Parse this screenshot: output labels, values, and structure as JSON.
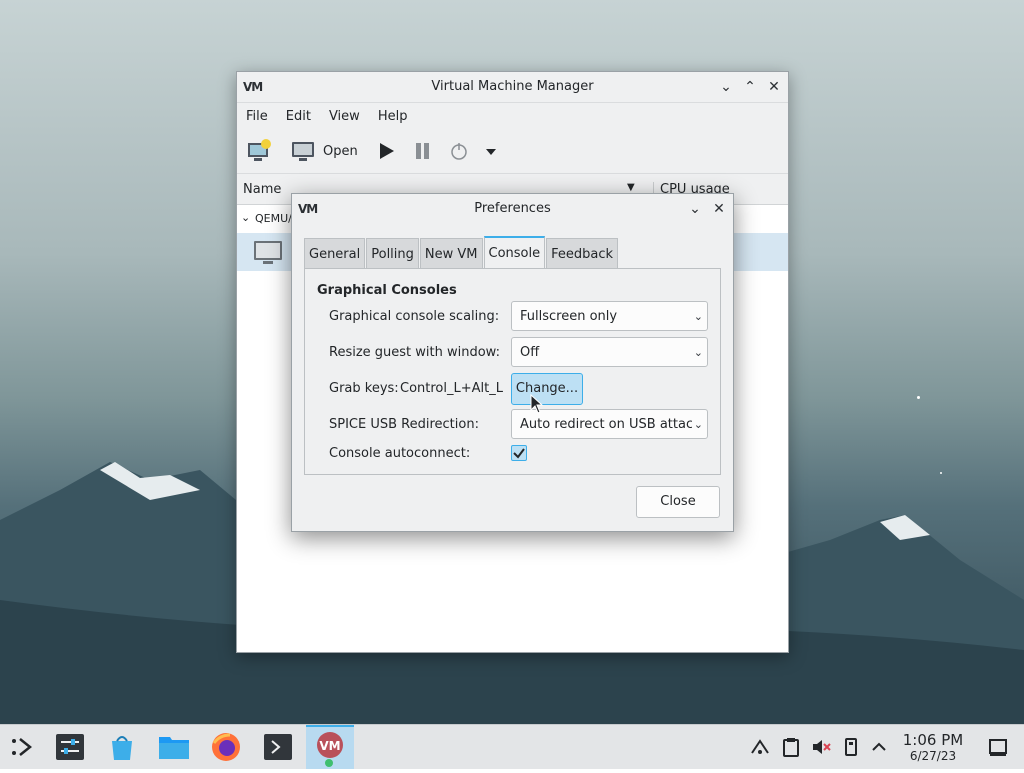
{
  "main_window": {
    "title": "Virtual Machine Manager",
    "logo": "VM",
    "menu": [
      "File",
      "Edit",
      "View",
      "Help"
    ],
    "toolbar": {
      "open_label": "Open"
    },
    "columns": {
      "name": "Name",
      "cpu": "CPU usage"
    },
    "group_label": "QEMU/"
  },
  "dialog": {
    "title": "Preferences",
    "logo": "VM",
    "tabs": [
      "General",
      "Polling",
      "New VM",
      "Console",
      "Feedback"
    ],
    "active_tab": "Console",
    "section_title": "Graphical Consoles",
    "scaling_label": "Graphical console scaling:",
    "scaling_value": "Fullscreen only",
    "resize_label": "Resize guest with window:",
    "resize_value": "Off",
    "grab_label": "Grab keys:",
    "grab_value": "Control_L+Alt_L",
    "change_label": "Change...",
    "usb_label": "SPICE USB Redirection:",
    "usb_value": "Auto redirect on USB attach",
    "autoconnect_label": "Console autoconnect:",
    "autoconnect_checked": true,
    "close_label": "Close"
  },
  "taskbar": {
    "time": "1:06 PM",
    "date": "6/27/23",
    "accent": "#3daee9",
    "tasks": [
      "app-launcher-icon",
      "system-settings-icon",
      "discover-icon",
      "file-manager-icon",
      "firefox-icon",
      "konsole-icon",
      "virt-manager-icon"
    ],
    "tray": [
      "network-icon",
      "clipboard-icon",
      "volume-muted-icon",
      "usb-device-icon",
      "tray-expand-icon",
      "show-desktop-icon"
    ]
  }
}
